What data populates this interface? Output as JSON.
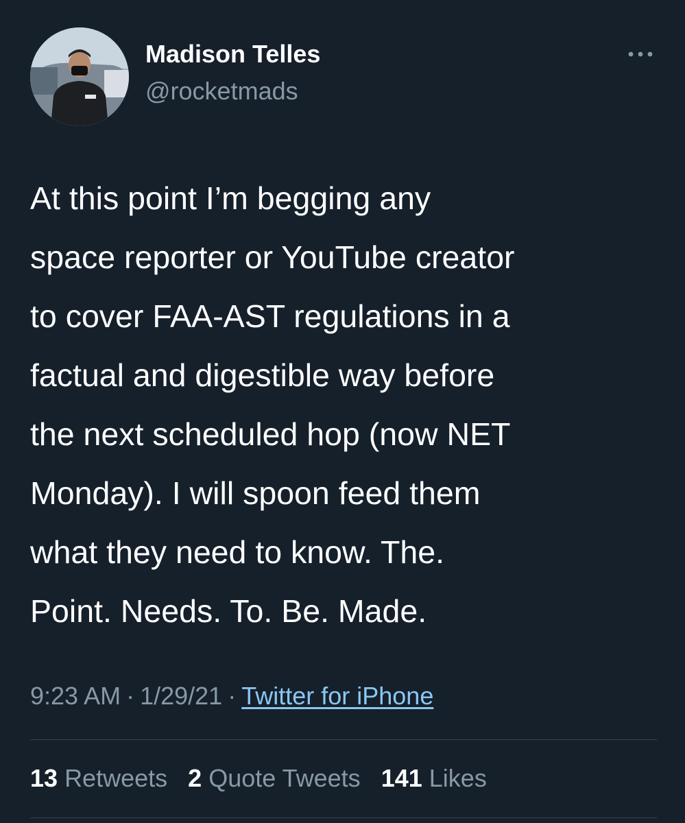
{
  "author": {
    "name": "Madison Telles",
    "handle": "@rocketmads",
    "avatar_icon": "profile-photo"
  },
  "menu": {
    "icon": "more-horizontal-icon"
  },
  "tweet": {
    "lines": [
      "At this point I’m begging any",
      "space reporter or YouTube creator",
      "to cover FAA-AST regulations in a",
      "factual and digestible way before",
      "the next scheduled hop (now NET",
      "Monday). I will spoon feed them",
      "what they need to know. The.",
      "Point. Needs. To. Be. Made."
    ]
  },
  "meta": {
    "time": "9:23 AM",
    "separator": "·",
    "date": "1/29/21",
    "source": "Twitter for iPhone"
  },
  "stats": {
    "retweets_count": "13",
    "retweets_label": "Retweets",
    "quotes_count": "2",
    "quotes_label": "Quote Tweets",
    "likes_count": "141",
    "likes_label": "Likes"
  },
  "colors": {
    "background": "#15202b",
    "text_primary": "#ffffff",
    "text_secondary": "#8899a6",
    "link": "#8ac7f2",
    "divider": "#38444d"
  }
}
